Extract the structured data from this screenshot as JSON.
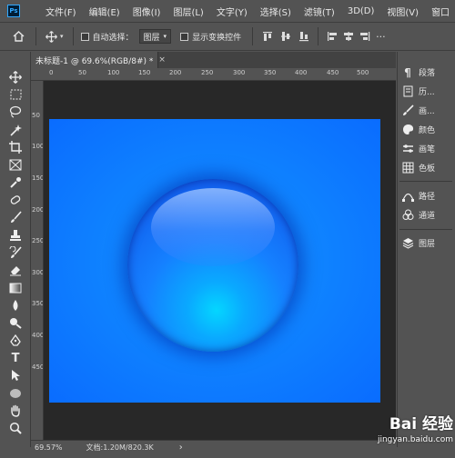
{
  "app": {
    "logo_text": "Ps",
    "accent": "#31a8ff"
  },
  "menu": [
    "文件(F)",
    "编辑(E)",
    "图像(I)",
    "图层(L)",
    "文字(Y)",
    "选择(S)",
    "滤镜(T)",
    "3D(D)",
    "视图(V)",
    "窗口"
  ],
  "options_bar": {
    "home_icon": "home-icon",
    "move_icon": "move-icon",
    "auto_select_label": "自动选择：",
    "auto_select_value": "图层",
    "show_transform_label": "显示变换控件",
    "align_icons": [
      "align-top-icon",
      "align-vcenter-icon",
      "align-bottom-icon",
      "align-left-icon",
      "align-hcenter-icon",
      "align-right-icon",
      "distribute-icon",
      "more-icon"
    ]
  },
  "document": {
    "tab_title": "未标题-1 @ 69.6%(RGB/8#) *",
    "tab_close": "×",
    "ruler_h": [
      "0",
      "50",
      "100",
      "150",
      "200",
      "250",
      "300",
      "350",
      "400",
      "450",
      "500"
    ],
    "ruler_v": [
      "50",
      "100",
      "150",
      "200",
      "250",
      "300",
      "350",
      "400",
      "450"
    ],
    "canvas_color": "#0f83ff",
    "sphere_core_color": "#04d6ff"
  },
  "status": {
    "zoom": "69.57%",
    "doc_info": "文档:1.20M/820.3K",
    "arrow": "›"
  },
  "panels": {
    "group1": [
      "段落",
      "历...",
      "画...",
      "颜色",
      "画笔",
      "色板"
    ],
    "group2": [
      "路径",
      "通道"
    ],
    "group3": [
      "图层"
    ]
  },
  "watermark": {
    "title": "Bai 经验",
    "sub": "jingyan.baidu.com"
  }
}
